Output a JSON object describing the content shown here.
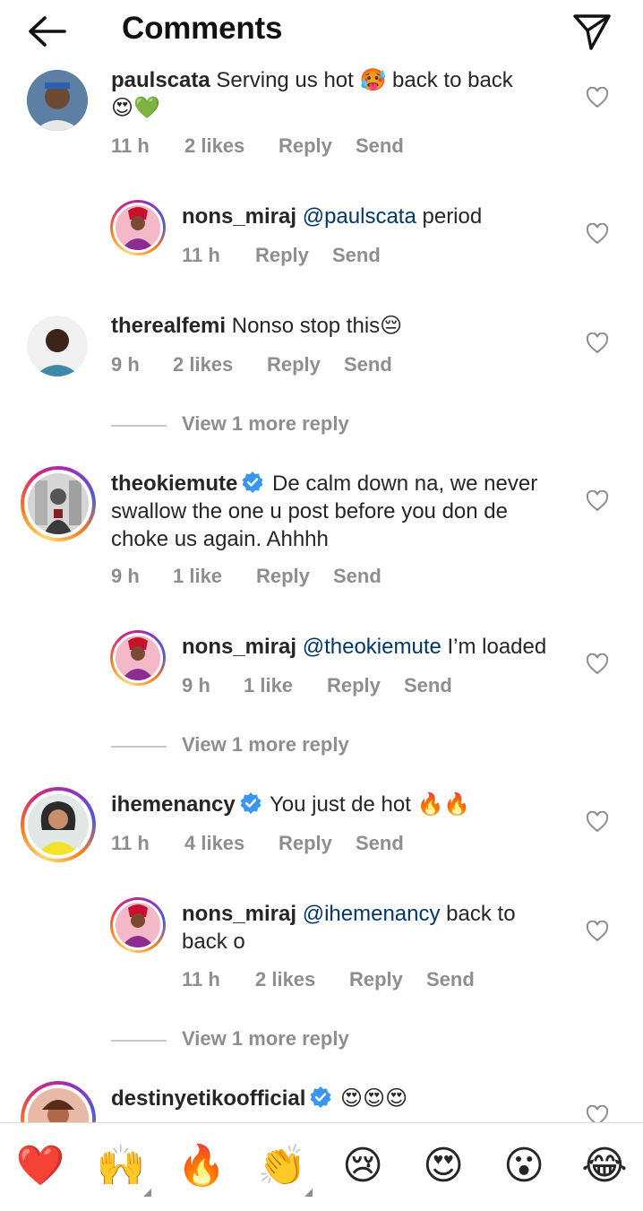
{
  "header": {
    "title": "Comments",
    "back_icon": "arrow-left-icon",
    "share_icon": "paper-plane-icon"
  },
  "comments": [
    {
      "username": "paulscata",
      "text_parts": [
        "Serving us hot ",
        "🥵",
        " back to back"
      ],
      "second_line": "😍💚",
      "time": "11 h",
      "likes": "2 likes",
      "reply": "Reply",
      "send": "Send"
    },
    {
      "username": "nons_miraj",
      "mention": "@paulscata",
      "text": " period",
      "time": "11 h",
      "reply": "Reply",
      "send": "Send"
    },
    {
      "username": "therealfemi",
      "text": " Nonso stop this😔",
      "time": "9 h",
      "likes": "2 likes",
      "reply": "Reply",
      "send": "Send",
      "view_more": "View 1 more reply"
    },
    {
      "username": "theokiemute",
      "verified": true,
      "text": " De calm down na, we never swallow the one u post before you don de choke us again. Ahhhh",
      "time": "9 h",
      "likes": "1 like",
      "reply": "Reply",
      "send": "Send"
    },
    {
      "username": "nons_miraj",
      "mention": "@theokiemute",
      "text": " I’m loaded",
      "time": "9 h",
      "likes": "1 like",
      "reply": "Reply",
      "send": "Send",
      "view_more": "View 1 more reply"
    },
    {
      "username": "ihemenancy",
      "verified": true,
      "text": " You just de hot 🔥🔥",
      "time": "11 h",
      "likes": "4 likes",
      "reply": "Reply",
      "send": "Send"
    },
    {
      "username": "nons_miraj",
      "mention": "@ihemenancy",
      "text": " back to back o",
      "time": "11 h",
      "likes": "2 likes",
      "reply": "Reply",
      "send": "Send",
      "view_more": "View 1 more reply"
    },
    {
      "username": "destinyetikoofficial",
      "verified": true,
      "text": " 😍😍😍"
    }
  ],
  "quick_reactions": [
    "❤️",
    "🙌",
    "🔥",
    "👏",
    "😢",
    "😍",
    "😮",
    "😂"
  ],
  "colors": {
    "verified": "#3897f0",
    "mention": "#00376b",
    "meta_gray": "#8e8e8e",
    "red_heart": "#ed4956"
  }
}
